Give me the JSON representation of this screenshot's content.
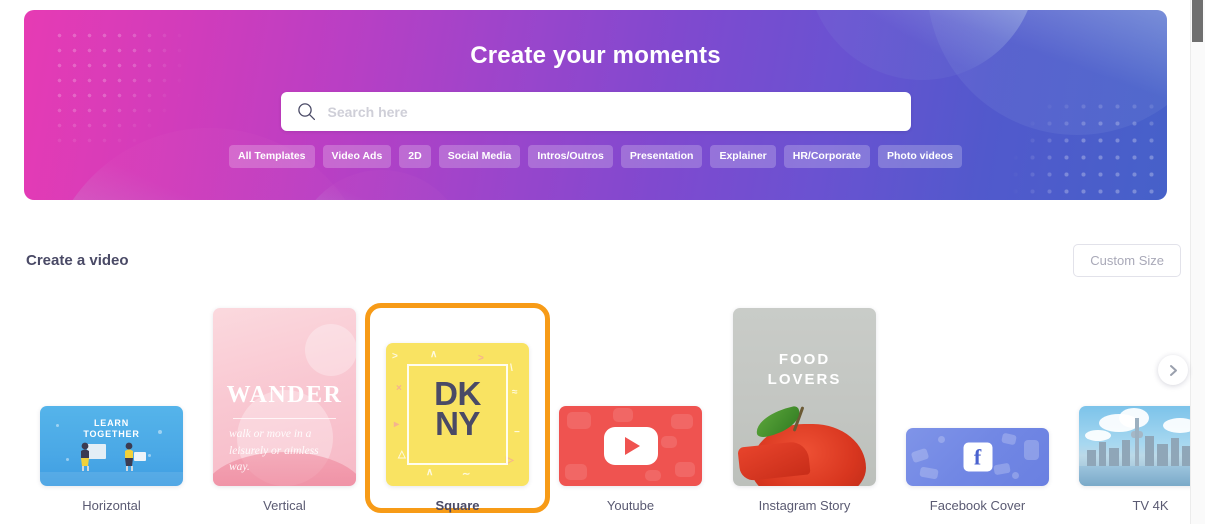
{
  "hero": {
    "title": "Create your moments",
    "search": {
      "placeholder": "Search here",
      "value": "",
      "icon": "search-icon"
    },
    "tags": [
      {
        "label": "All Templates"
      },
      {
        "label": "Video Ads"
      },
      {
        "label": "2D"
      },
      {
        "label": "Social Media"
      },
      {
        "label": "Intros/Outros"
      },
      {
        "label": "Presentation"
      },
      {
        "label": "Explainer"
      },
      {
        "label": "HR/Corporate"
      },
      {
        "label": "Photo videos"
      }
    ],
    "colors": {
      "gradient_start": "#e63bb4",
      "gradient_mid": "#8049cf",
      "gradient_end": "#4661c9"
    }
  },
  "section": {
    "title": "Create a video",
    "custom_size_label": "Custom Size"
  },
  "carousel": {
    "next_label": "›",
    "selected_index": 2,
    "selection_color": "#f79b17",
    "cards": [
      {
        "label": "Horizontal",
        "thumb_kind": "learn-together",
        "thumb_text_line1": "LEARN",
        "thumb_text_line2": "TOGETHER",
        "color": "#4aa8e6",
        "selected": false
      },
      {
        "label": "Vertical",
        "thumb_kind": "wander",
        "thumb_title": "WANDER",
        "thumb_sub": "walk or move in a leisurely or aimless way.",
        "color": "#f9c8d2",
        "selected": false
      },
      {
        "label": "Square",
        "thumb_kind": "dkny",
        "thumb_text_line1": "DK",
        "thumb_text_line2": "NY",
        "color": "#f9e362",
        "selected": true
      },
      {
        "label": "Youtube",
        "thumb_kind": "youtube-play",
        "color": "#ef5350",
        "selected": false
      },
      {
        "label": "Instagram Story",
        "thumb_kind": "food-lovers",
        "thumb_text_line1": "FOOD",
        "thumb_text_line2": "LOVERS",
        "color": "#c3c6c2",
        "selected": false
      },
      {
        "label": "Facebook Cover",
        "thumb_kind": "facebook",
        "thumb_glyph": "f",
        "color": "#7187e4",
        "selected": false
      },
      {
        "label": "TV 4K",
        "thumb_kind": "city-skyline",
        "color": "#a8d8f0",
        "selected": false
      }
    ]
  },
  "scrollbar": {
    "thumb_position": "top"
  }
}
